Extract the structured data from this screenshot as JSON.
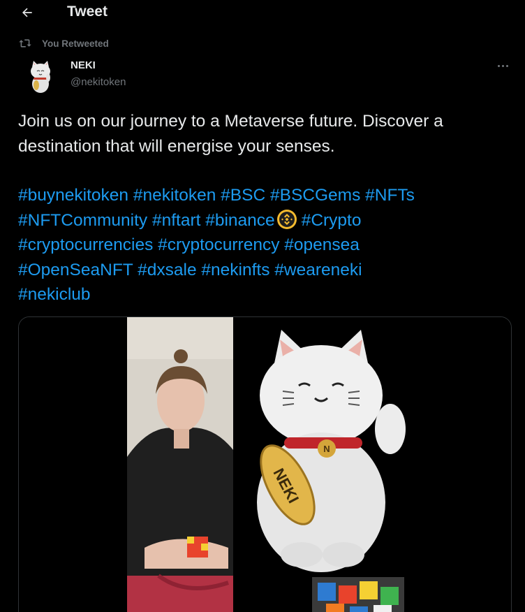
{
  "header": {
    "back_icon": "arrow-left-icon",
    "title": "Tweet"
  },
  "retweet": {
    "icon": "retweet-icon",
    "label": "You Retweeted"
  },
  "author": {
    "avatar": "neki-cat-avatar",
    "name": "NEKI",
    "handle": "@nekitoken",
    "more_icon": "more-dots-icon"
  },
  "tweet": {
    "text": "Join us on our journey to a Metaverse future. Discover a destination that will energise your senses.",
    "hashtags": {
      "buynekitoken": "#buynekitoken",
      "nekitoken": "#nekitoken",
      "bsc": "#BSC",
      "bscgems": "#BSCGems",
      "nfts": "#NFTs",
      "nftcommunity": "#NFTCommunity",
      "nftart": "#nftart",
      "binance": "#binance",
      "crypto": "#Crypto",
      "cryptocurrencies": "#cryptocurrencies",
      "cryptocurrency": "#cryptocurrency",
      "opensea": "#opensea",
      "openseanft": "#OpenSeaNFT",
      "dxsale": "#dxsale",
      "nekinfts": "#nekinfts",
      "weareneki": "#weareneki",
      "nekiclub": "#nekiclub"
    },
    "emoji": "binance-coin-emoji"
  },
  "media": {
    "coin_text": "NEKI",
    "collar_tag": "N"
  },
  "colors": {
    "background": "#000000",
    "text": "#e7e9ea",
    "muted": "#71767b",
    "link": "#1d9bf0",
    "border": "#2f3336",
    "binance": "#f3ba2f"
  }
}
